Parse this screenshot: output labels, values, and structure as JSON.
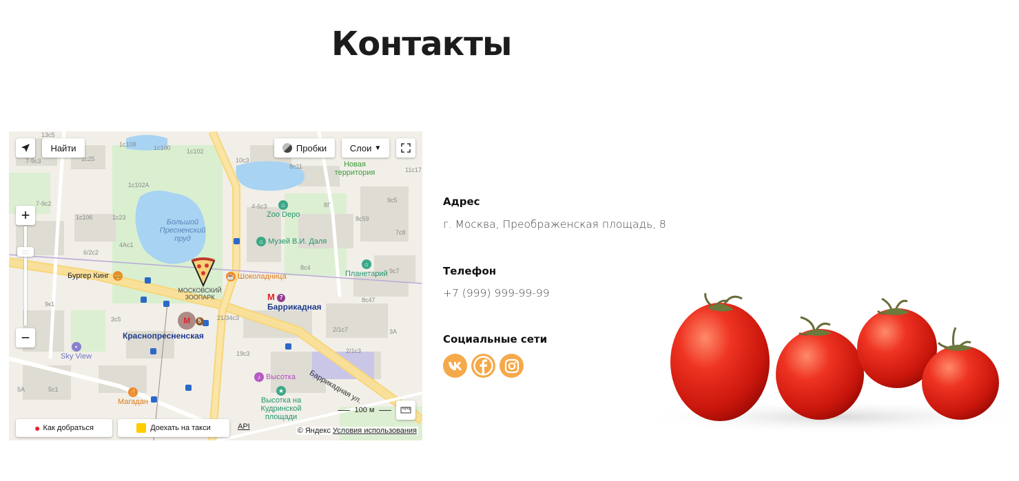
{
  "page": {
    "title": "Контакты"
  },
  "map": {
    "find_button": "Найти",
    "traffic_button": "Пробки",
    "layers_button": "Слои",
    "route_button": "Как добраться",
    "taxi_button": "Доехать на такси",
    "api_link": "API",
    "copyright": "© Яндекс",
    "terms_link": "Условия использования",
    "scale": "100 м",
    "places": {
      "pond": "Большой Пресненский пруд",
      "zoo": "МОСКОВСКИЙ ЗООПАРК",
      "zoo_depo": "Zoo Depo",
      "museum": "Музей В.И. Даля",
      "new_territory": "Новая территория",
      "shokoladnitsa": "Шоколадница",
      "burger_king": "Бургер Кинг",
      "planetarium": "Планетарий",
      "barrikadnaya": "Баррикадная",
      "krasnopresnenskaya": "Краснопресненская",
      "sky_view": "Sky View",
      "magadan": "Магадан",
      "vysotka": "Высотка",
      "vysotka_kudrinskaya": "Высотка на Кудринской площади",
      "barrikadnaya_street": "Баррикадная ул.",
      "metro_line_7": "7",
      "metro_line_5": "5"
    },
    "houses": [
      "13с5",
      "1с108",
      "1с100",
      "1с102",
      "10с3",
      "8с11",
      "11с17",
      "7-9с3",
      "1с25",
      "1с102А",
      "4-6с3",
      "8Г",
      "9с5",
      "7-9с2",
      "1с106",
      "1с23",
      "8с59",
      "7с8",
      "4Ас1",
      "6/2с2",
      "8с4",
      "9с7",
      "9к1",
      "3с5",
      "8с47",
      "21/34с3",
      "2/1с7",
      "3А",
      "2/1с3",
      "19с3",
      "5с1",
      "5А"
    ]
  },
  "contacts": {
    "address_label": "Адрес",
    "address_value": "г. Москва, Преображенская площадь, 8",
    "phone_label": "Телефон",
    "phone_value": "+7 (999) 999-99-99",
    "social_label": "Социальные сети"
  },
  "social": [
    {
      "name": "vk-icon"
    },
    {
      "name": "facebook-icon"
    },
    {
      "name": "instagram-icon"
    }
  ],
  "colors": {
    "accent": "#f5a94a",
    "tomato": "#e8231a"
  }
}
